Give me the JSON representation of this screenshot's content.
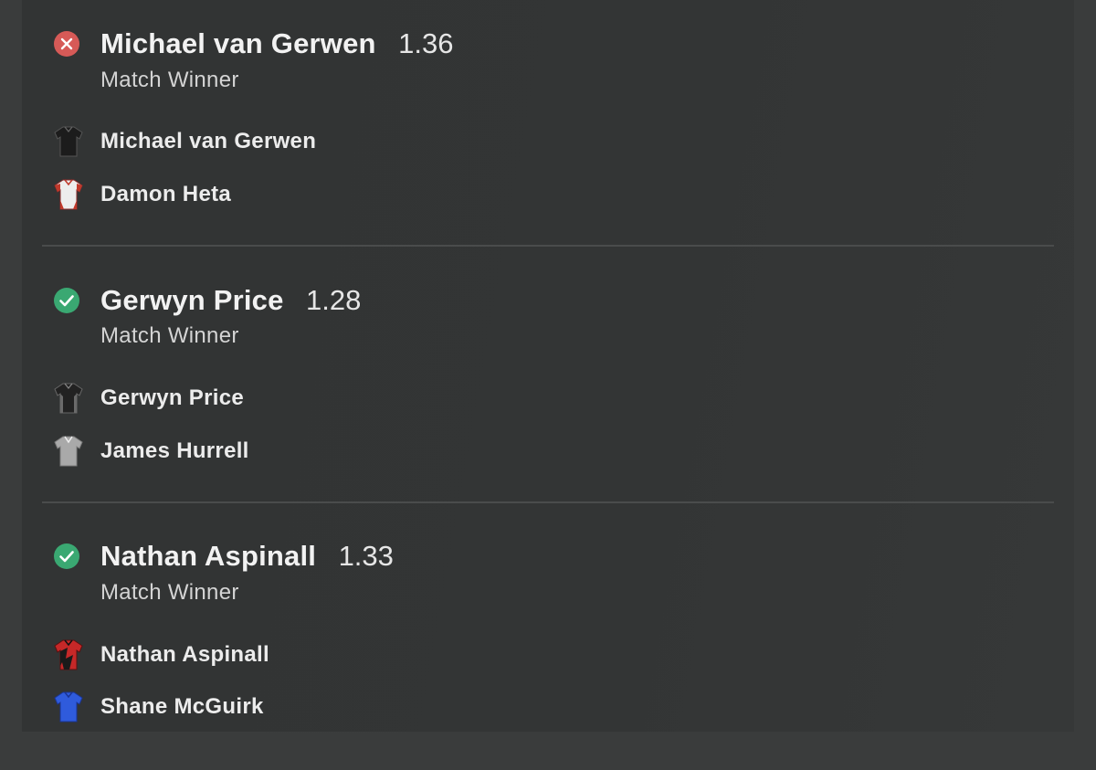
{
  "bets": [
    {
      "status": "lost",
      "selection": "Michael van Gerwen",
      "odds": "1.36",
      "market": "Match Winner",
      "participants": [
        {
          "name": "Michael van Gerwen",
          "shirt_icon": "black-shirt-icon"
        },
        {
          "name": "Damon Heta",
          "shirt_icon": "white-red-shirt-icon"
        }
      ]
    },
    {
      "status": "won",
      "selection": "Gerwyn Price",
      "odds": "1.28",
      "market": "Match Winner",
      "participants": [
        {
          "name": "Gerwyn Price",
          "shirt_icon": "black-grey-shirt-icon"
        },
        {
          "name": "James Hurrell",
          "shirt_icon": "grey-shirt-icon"
        }
      ]
    },
    {
      "status": "won",
      "selection": "Nathan Aspinall",
      "odds": "1.33",
      "market": "Match Winner",
      "participants": [
        {
          "name": "Nathan Aspinall",
          "shirt_icon": "red-black-shirt-icon"
        },
        {
          "name": "Shane McGuirk",
          "shirt_icon": "blue-shirt-icon"
        }
      ]
    }
  ],
  "colors": {
    "lost": "#d9534f",
    "won": "#3aa872",
    "background": "#323434",
    "divider": "#4a4c4c"
  }
}
